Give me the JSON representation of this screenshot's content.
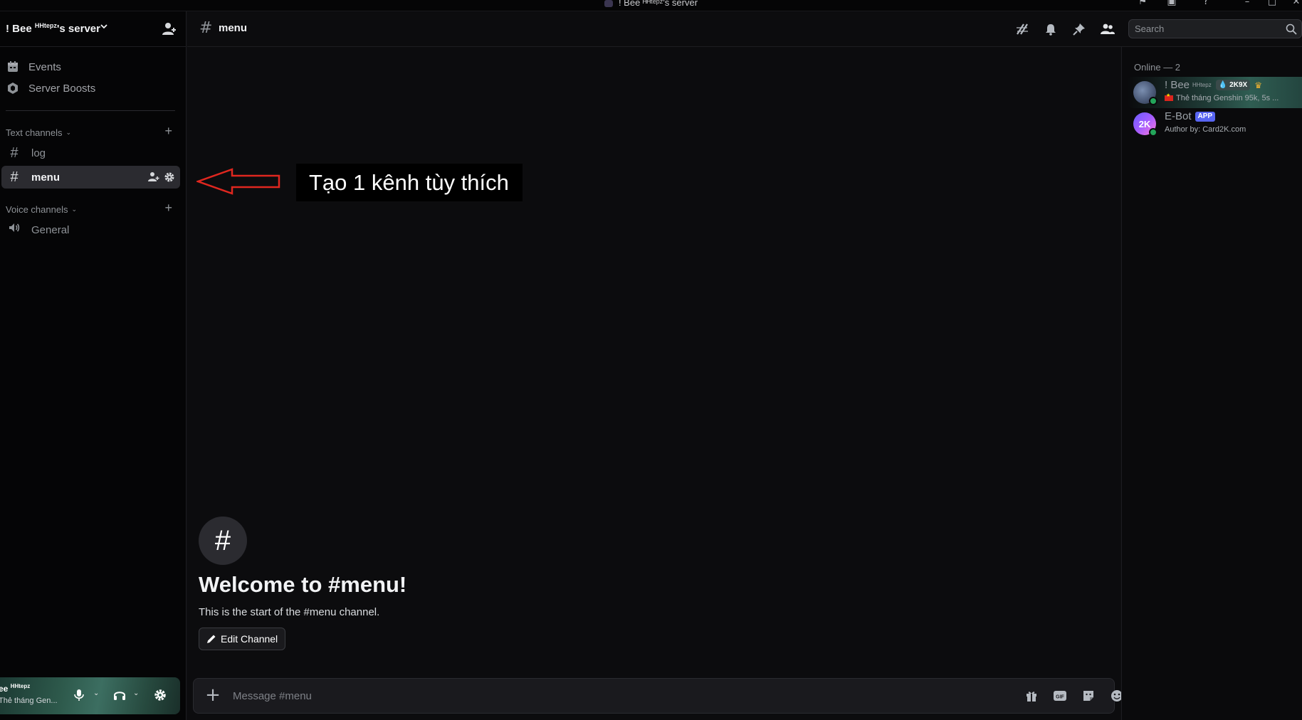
{
  "window": {
    "title": "! Bee ᴴᴴᵗᵉᵖᶻ's server"
  },
  "server": {
    "name": "! Bee",
    "name_sup": "HHtepz",
    "name_suffix": "'s server"
  },
  "sidebar": {
    "nav": [
      {
        "label": "Events",
        "icon": "calendar-icon"
      },
      {
        "label": "Server Boosts",
        "icon": "boost-gem-icon"
      }
    ],
    "text_category": "Text channels",
    "voice_category": "Voice channels",
    "text_channels": [
      {
        "name": "log",
        "active": false
      },
      {
        "name": "menu",
        "active": true
      }
    ],
    "voice_channels": [
      {
        "name": "General"
      }
    ]
  },
  "user_panel": {
    "name": "ee",
    "name_sup": "HHtepz",
    "status": "Thẻ tháng Gen..."
  },
  "channel_header": {
    "name": "menu",
    "search_placeholder": "Search"
  },
  "welcome": {
    "icon_glyph": "#",
    "title": "Welcome to #menu!",
    "subtitle": "This is the start of the #menu channel.",
    "edit_button": "Edit Channel"
  },
  "composer": {
    "placeholder": "Message #menu"
  },
  "annotation": {
    "text": "Tạo 1 kênh tùy thích",
    "color": "#e0271f"
  },
  "members": {
    "header": "Online — 2",
    "list": [
      {
        "name": "! Bee",
        "sup": "HHtepz",
        "tag": "2K9X",
        "status": "Thẻ tháng Genshin 95k, 5s ..."
      },
      {
        "name": "E-Bot",
        "badge": "APP",
        "status": "Author by: Card2K.com"
      }
    ]
  },
  "colors": {
    "online": "#23a55a",
    "app_badge": "#5865f2",
    "crown": "#f0b232"
  }
}
